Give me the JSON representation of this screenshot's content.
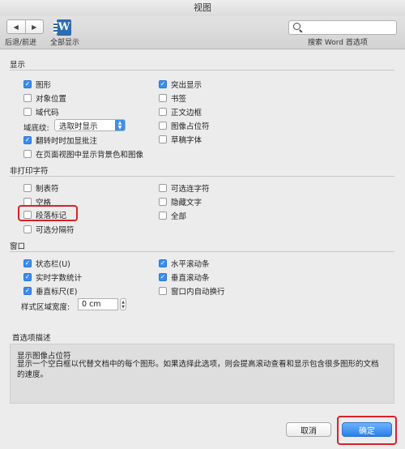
{
  "window": {
    "title": "视图"
  },
  "toolbar": {
    "back_forward_label": "后退/前进",
    "show_all_label": "全部显示",
    "search_placeholder": "",
    "search_hint": "搜索 Word 首选项"
  },
  "display": {
    "heading": "显示",
    "left_items": [
      {
        "label": "图形",
        "checked": true
      },
      {
        "label": "对象位置",
        "checked": false
      },
      {
        "label": "域代码",
        "checked": false
      }
    ],
    "shading_label": "域底纹:",
    "shading_value": "选取时显示",
    "left_items2": [
      {
        "label": "翻转时时加显批注",
        "checked": true
      },
      {
        "label": "在页面视图中显示背景色和图像",
        "checked": false
      }
    ],
    "right_items": [
      {
        "label": "突出显示",
        "checked": true
      },
      {
        "label": "书签",
        "checked": false
      },
      {
        "label": "正文边框",
        "checked": false
      },
      {
        "label": "图像占位符",
        "checked": false
      },
      {
        "label": "草稿字体",
        "checked": false
      }
    ]
  },
  "nonprint": {
    "heading": "非打印字符",
    "left_items": [
      {
        "label": "制表符",
        "checked": false
      },
      {
        "label": "空格",
        "checked": false
      },
      {
        "label": "段落标记",
        "checked": false
      },
      {
        "label": "可选分隔符",
        "checked": false
      }
    ],
    "right_items": [
      {
        "label": "可选连字符",
        "checked": false
      },
      {
        "label": "隐藏文字",
        "checked": false
      },
      {
        "label": "全部",
        "checked": false
      }
    ]
  },
  "window_section": {
    "heading": "窗口",
    "left_items": [
      {
        "label": "状态栏(U)",
        "checked": true
      },
      {
        "label": "实时字数统计",
        "checked": true
      },
      {
        "label": "垂直标尺(E)",
        "checked": true
      }
    ],
    "right_items": [
      {
        "label": "水平滚动条",
        "checked": true
      },
      {
        "label": "垂直滚动条",
        "checked": true
      },
      {
        "label": "窗口内自动换行",
        "checked": false
      }
    ],
    "style_area_label": "样式区域宽度:",
    "style_area_value": "0 cm"
  },
  "description": {
    "heading": "首选项描述",
    "title": "显示图像占位符",
    "text": "显示一个空白框以代替文档中的每个图形。如果选择此选项，则会提高滚动查看和显示包含很多图形的文档的速度。"
  },
  "buttons": {
    "cancel": "取消",
    "ok": "确定"
  },
  "colors": {
    "accent": "#3a8ef0",
    "highlight": "#d8232a"
  }
}
